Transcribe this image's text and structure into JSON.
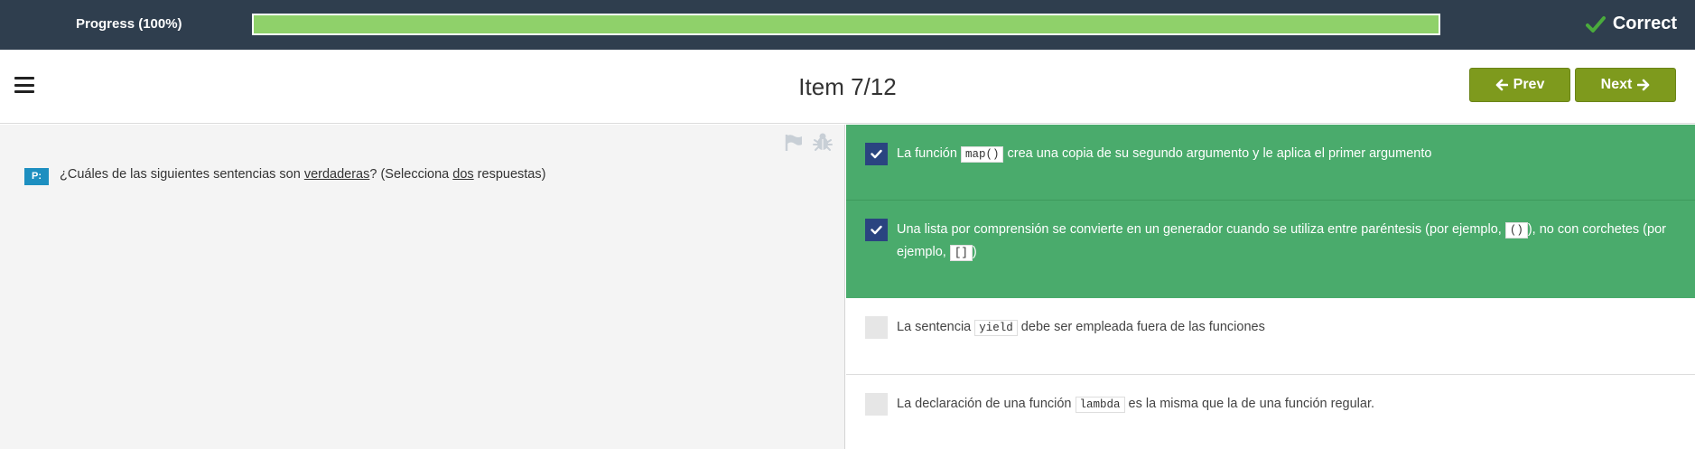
{
  "progress": {
    "label": "Progress (100%)",
    "percent": 100,
    "status": "Correct",
    "fill_color": "#8fd16a",
    "bar_color": "#2f3e4e"
  },
  "header": {
    "title": "Item 7/12",
    "prev_label": "Prev",
    "next_label": "Next",
    "button_color": "#7e9a1d"
  },
  "question": {
    "badge": "P:",
    "text_before": "¿Cuáles de las siguientes sentencias son ",
    "emphasis1": "verdaderas",
    "text_middle": "? (Selecciona ",
    "emphasis2": "dos",
    "text_after": " respuestas)"
  },
  "options": [
    {
      "selected": true,
      "before": "La función ",
      "code": "map()",
      "after": " crea una copia de su segundo argumento y le aplica el primer argumento"
    },
    {
      "selected": true,
      "before": "Una lista por comprensión se convierte en un generador cuando se utiliza entre paréntesis (por ejemplo, ",
      "code": "()",
      "middle": "), no con corchetes (por ejemplo, ",
      "code2": "[]",
      "after": ")"
    },
    {
      "selected": false,
      "before": "La sentencia ",
      "code": "yield",
      "after": " debe ser empleada fuera de las funciones"
    },
    {
      "selected": false,
      "before": "La declaración de una función ",
      "code": "lambda",
      "after": " es la misma que la de una función regular."
    }
  ],
  "colors": {
    "selected_bg": "#4aab6c",
    "checkbox_on": "#2a4480",
    "badge": "#1d8fc0"
  },
  "icons": [
    "check-icon",
    "menu-icon",
    "arrow-left-icon",
    "arrow-right-icon",
    "flag-icon",
    "bug-icon",
    "checkbox-check-icon"
  ]
}
